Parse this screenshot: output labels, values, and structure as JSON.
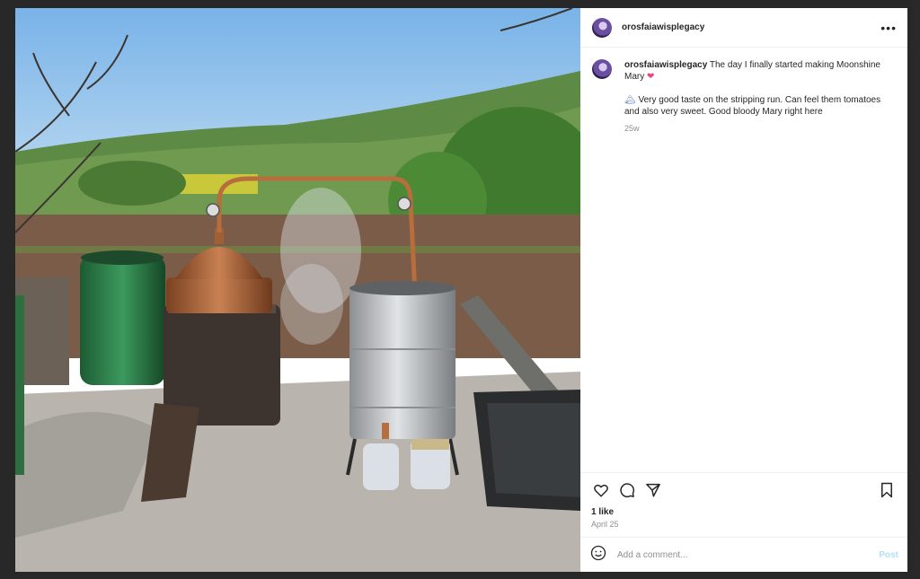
{
  "post": {
    "author": "orosfaiawisplegacy",
    "caption_line1": "The day I finally started making Moonshine Mary",
    "caption_heart": "❤",
    "caption_mountain": "🏔",
    "caption_line2": "Very good taste on the stripping run. Can feel them tomatoes and also very sweet. Good bloody Mary right here",
    "time_ago": "25w",
    "likes": "1 like",
    "date": "April 25"
  },
  "header": {
    "more_label": "•••"
  },
  "comment": {
    "placeholder": "Add a comment...",
    "post_label": "Post"
  },
  "icons": {
    "like": "heart-icon",
    "comment": "comment-icon",
    "share": "share-icon",
    "save": "bookmark-icon",
    "emoji": "emoji-icon"
  },
  "colors": {
    "text": "#262626",
    "muted": "#8e8e8e",
    "post_button": "#b2dffc",
    "heart": "#ed4383"
  },
  "photo": {
    "description": ""
  }
}
